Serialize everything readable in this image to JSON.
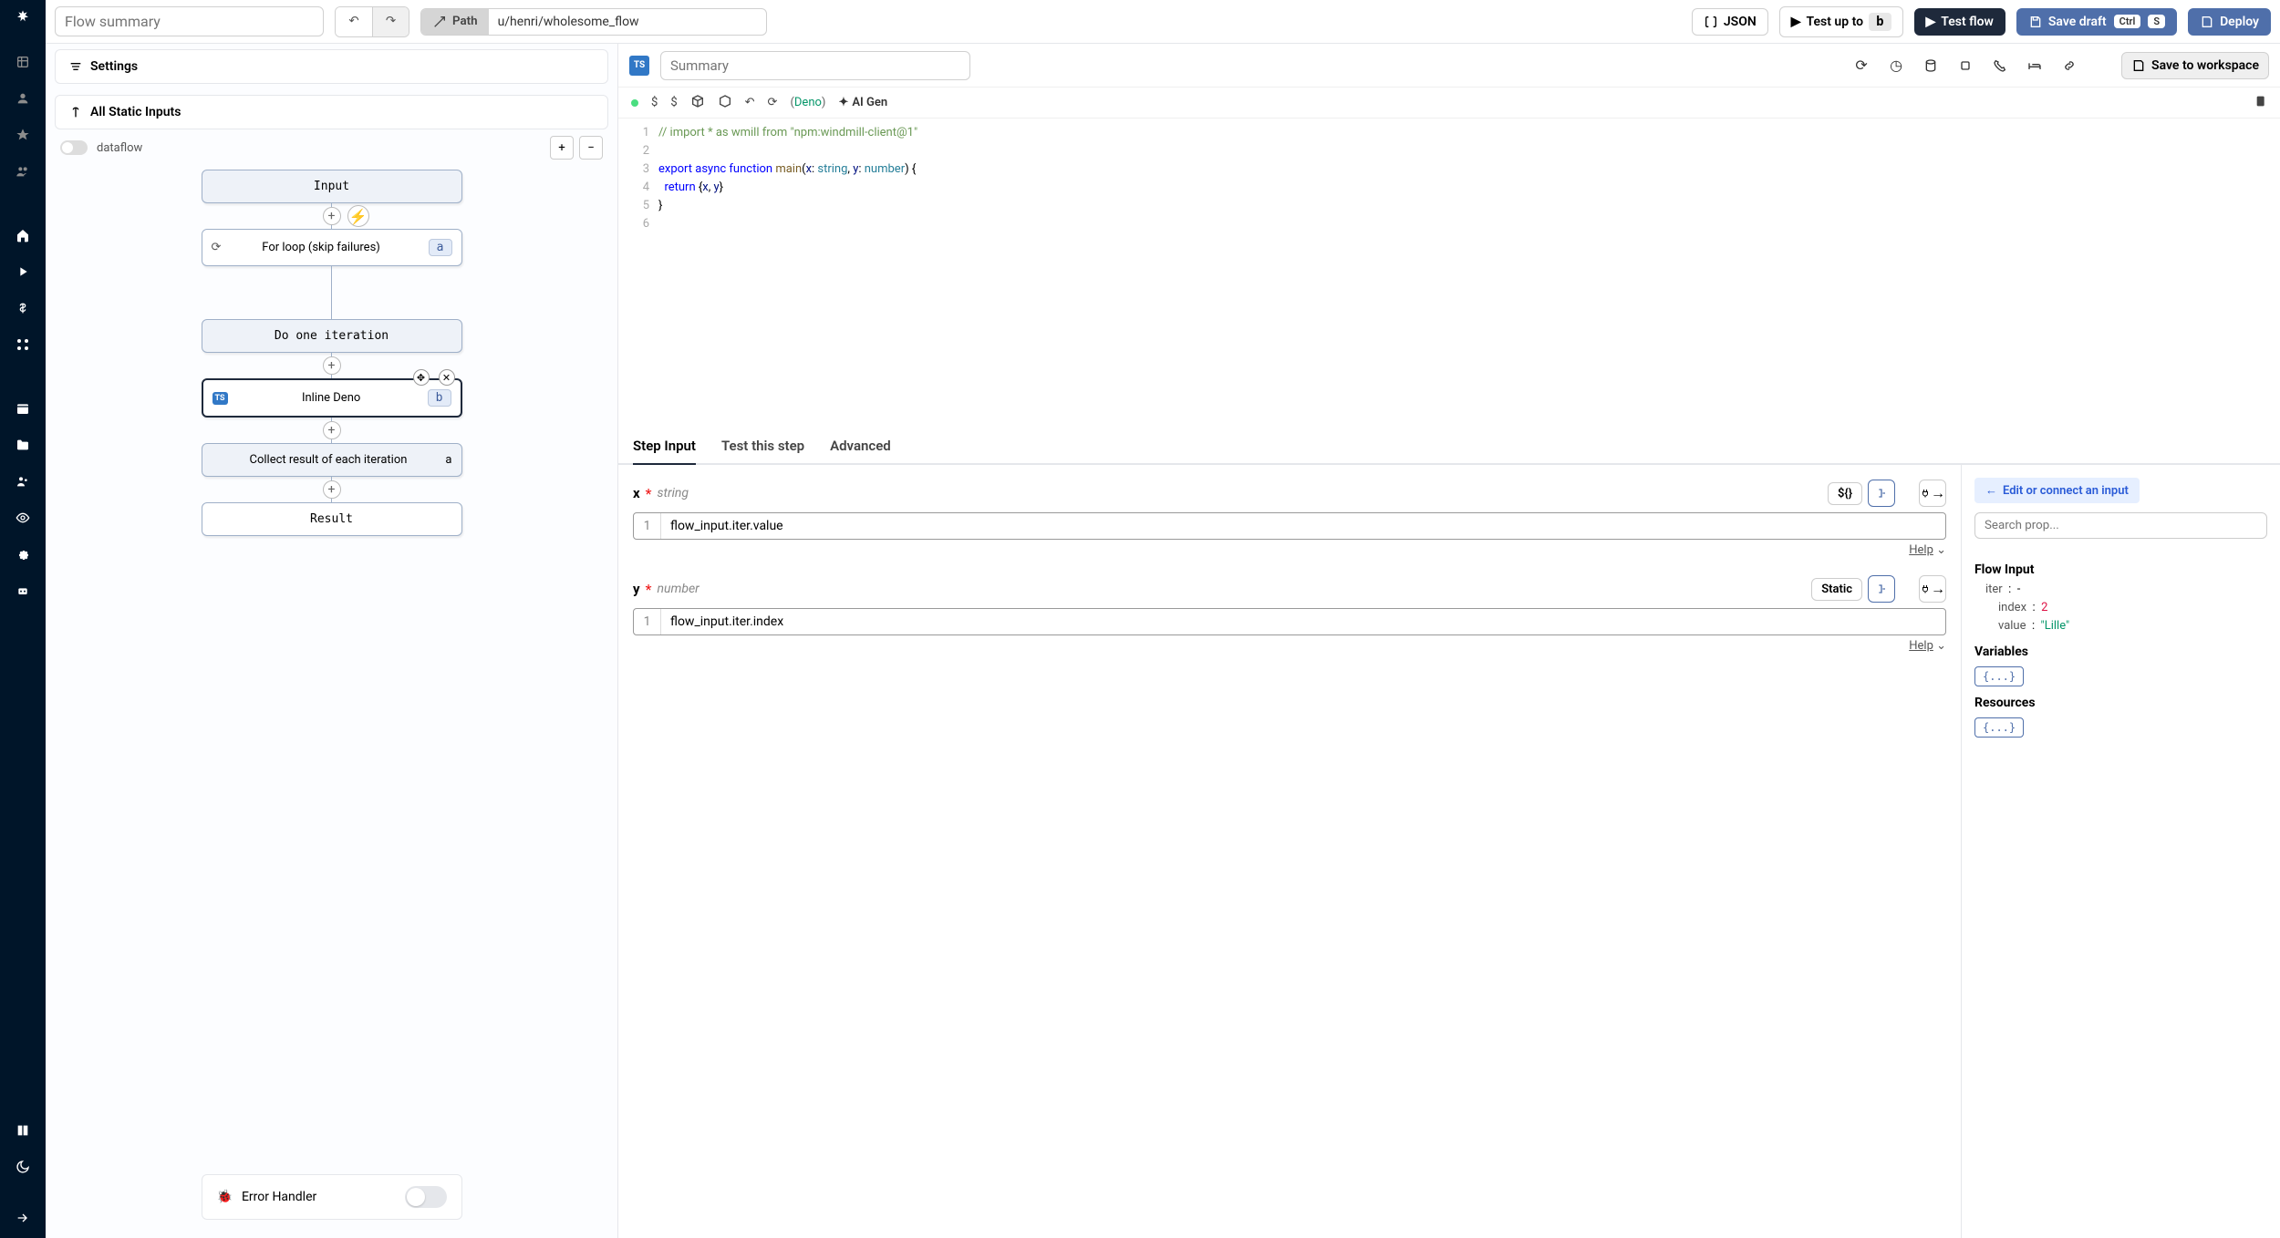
{
  "topbar": {
    "flow_summary_placeholder": "Flow summary",
    "path_label": "Path",
    "path_value": "u/henri/wholesome_flow",
    "json_btn": "JSON",
    "test_up_to": "Test up to",
    "test_up_to_badge": "b",
    "test_flow": "Test flow",
    "save_draft": "Save draft",
    "save_draft_kbd1": "Ctrl",
    "save_draft_kbd2": "S",
    "deploy": "Deploy"
  },
  "left_pane": {
    "settings": "Settings",
    "all_static": "All Static Inputs",
    "dataflow": "dataflow",
    "nodes": {
      "input": "Input",
      "loop": "For loop (skip failures)",
      "loop_badge": "a",
      "do_one": "Do one iteration",
      "inline": "Inline Deno",
      "inline_badge": "b",
      "collect": "Collect result of each iteration",
      "collect_badge": "a",
      "result": "Result"
    },
    "error_handler": "Error Handler"
  },
  "right_header": {
    "summary_placeholder": "Summary",
    "save_ws": "Save to workspace"
  },
  "editor_toolbar": {
    "deno_open": "(",
    "deno": "Deno",
    "deno_close": ")",
    "ai_gen": "AI Gen"
  },
  "code": {
    "l1": "// import * as wmill from \"npm:windmill-client@1\"",
    "l3a": "export ",
    "l3b": "async ",
    "l3c": "function ",
    "l3d": "main",
    "l3e": "(",
    "l3f": "x",
    "l3g": ": ",
    "l3h": "string",
    "l3i": ", ",
    "l3j": "y",
    "l3k": ": ",
    "l3l": "number",
    "l3m": ") {",
    "l4a": "  return ",
    "l4b": "{",
    "l4c": "x",
    "l4d": ", ",
    "l4e": "y",
    "l4f": "}",
    "l5": "}"
  },
  "tabs": {
    "step_input": "Step Input",
    "test_step": "Test this step",
    "advanced": "Advanced"
  },
  "inputs": {
    "x_name": "x",
    "x_type": "string",
    "x_mode": "${}",
    "x_val": "flow_input.iter.value",
    "y_name": "y",
    "y_type": "number",
    "y_mode": "Static",
    "y_val": "flow_input.iter.index",
    "help": "Help"
  },
  "inspect": {
    "edit_connect": "Edit or connect an input",
    "search_placeholder": "Search prop...",
    "flow_input": "Flow Input",
    "iter": "iter",
    "index": "index",
    "index_val": "2",
    "value": "value",
    "value_val": "\"Lille\"",
    "variables": "Variables",
    "resources": "Resources",
    "obj": "{...}"
  }
}
